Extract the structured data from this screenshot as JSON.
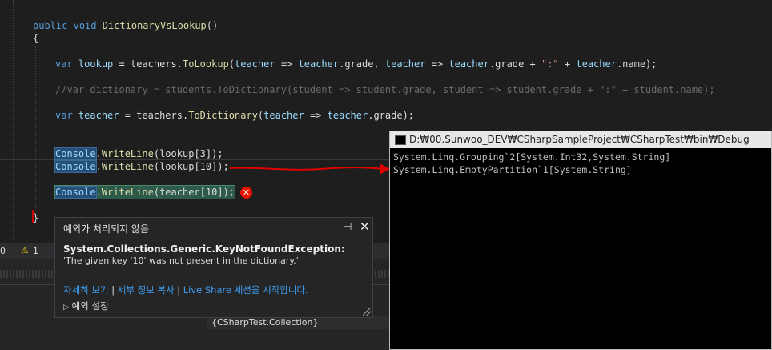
{
  "code": {
    "signature": {
      "kw1": "public",
      "kw2": "void",
      "name": "DictionaryVsLookup",
      "parens": "()"
    },
    "open_brace": "{",
    "close_brace": "}",
    "lookup_line": {
      "kw": "var",
      "var": "lookup",
      "eq": " = ",
      "obj": "teachers",
      "dot": ".",
      "method": "ToLookup",
      "p1": "(",
      "a1": "teacher",
      "arr1": " => ",
      "a1b": "teacher",
      "prop1": ".grade, ",
      "a2": "teacher",
      "arr2": " => ",
      "a2b": "teacher",
      "prop2": ".grade + ",
      "str": "\":\"",
      "plus": " + ",
      "a3": "teacher",
      "prop3": ".name);"
    },
    "comment_line": "//var dictionary = students.ToDictionary(student => student.grade, student => student.grade + \":\" + student.name);",
    "teacher_line": {
      "kw": "var",
      "var": "teacher",
      "eq": " = ",
      "obj": "teachers",
      "dot": ".",
      "method": "ToDictionary",
      "p1": "(",
      "a1": "teacher",
      "arr": " => ",
      "a1b": "teacher",
      "rest": ".grade);"
    },
    "wl1": {
      "cls": "Console",
      "dot": ".",
      "method": "WriteLine",
      "open": "(",
      "arg": "lookup",
      "idx": "[3]",
      "close": ");"
    },
    "wl2": {
      "cls": "Console",
      "dot": ".",
      "method": "WriteLine",
      "open": "(",
      "arg": "lookup",
      "idx": "[10]",
      "close": ");"
    },
    "wl3": {
      "cls": "Console",
      "dot": ".",
      "method": "WriteLine",
      "open": "(",
      "arg": "teacher",
      "idx": "[10]",
      "close": ");"
    }
  },
  "error_icon_glyph": "✕",
  "status_bar": {
    "left_count": "0",
    "warning_glyph": "⚠",
    "warning_count": "1"
  },
  "console": {
    "title": "D:₩00.Sunwoo_DEV₩CSharpSampleProject₩CSharpTest₩bin₩Debug",
    "lines": [
      "System.Linq.Grouping`2[System.Int32,System.String]",
      "System.Linq.EmptyPartition`1[System.String]"
    ]
  },
  "exception_popup": {
    "title": "예외가 처리되지 않음",
    "pin_glyph": "⊣",
    "close_glyph": "✕",
    "type": "System.Collections.Generic.KeyNotFoundException:",
    "message": "'The given key '10' was not present in the dictionary.'",
    "link_view_details": "자세히 보기",
    "sep": " | ",
    "link_copy_details": "세부 정보 복사",
    "link_live_share": "Live Share 세션을 시작합니다.",
    "settings_glyph": "▷",
    "settings_label": "예외 설정"
  },
  "bottom_tab_label": "{CSharpTest.Collection}",
  "colors": {
    "arrow": "#e00000",
    "link": "#3e9cf0",
    "error": "#e51400"
  }
}
